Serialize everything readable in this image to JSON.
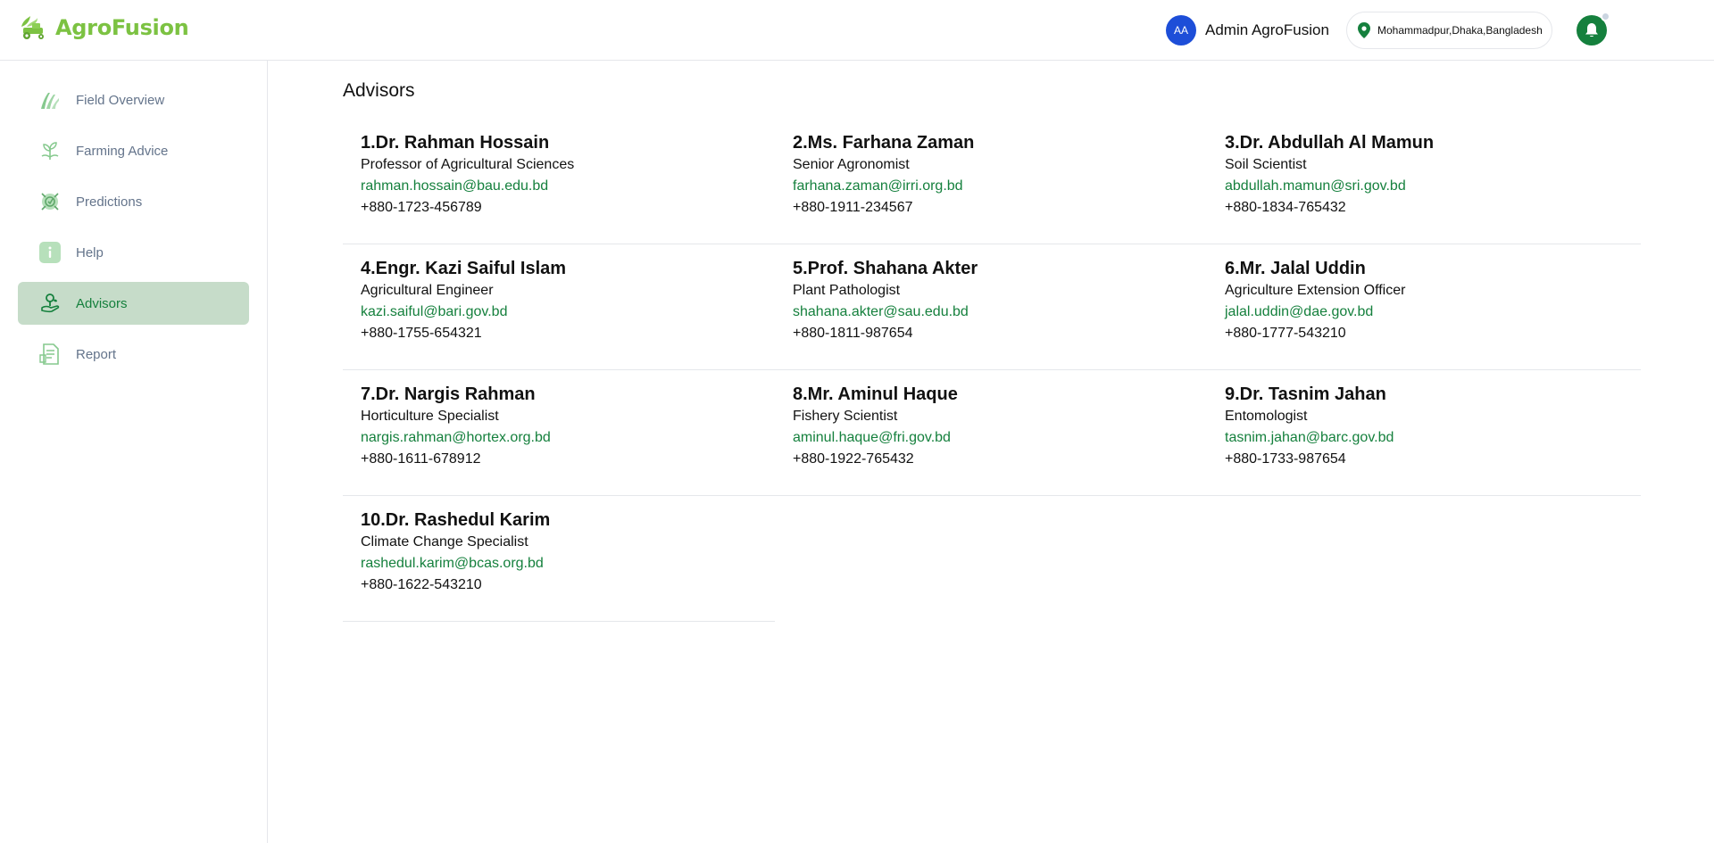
{
  "brand": {
    "name": "AgroFusion"
  },
  "header": {
    "avatar_initials": "AA",
    "user_name": "Admin AgroFusion",
    "location": "Mohammadpur,Dhaka,Bangladesh"
  },
  "colors": {
    "brand_green": "#7cc242",
    "accent_green": "#15803d",
    "active_bg": "#c6dcc9",
    "avatar_blue": "#1d4ed8"
  },
  "sidebar": {
    "items": [
      {
        "label": "Field Overview",
        "icon": "field-icon",
        "active": false
      },
      {
        "label": "Farming Advice",
        "icon": "sprout-icon",
        "active": false
      },
      {
        "label": "Predictions",
        "icon": "prediction-icon",
        "active": false
      },
      {
        "label": "Help",
        "icon": "info-icon",
        "active": false
      },
      {
        "label": "Advisors",
        "icon": "advisor-icon",
        "active": true
      },
      {
        "label": "Report",
        "icon": "report-icon",
        "active": false
      }
    ]
  },
  "main": {
    "title": "Advisors",
    "advisors": [
      {
        "name": "1.Dr. Rahman Hossain",
        "title": "Professor of Agricultural Sciences",
        "email": "rahman.hossain@bau.edu.bd",
        "phone": "+880-1723-456789"
      },
      {
        "name": "2.Ms. Farhana Zaman",
        "title": "Senior Agronomist",
        "email": "farhana.zaman@irri.org.bd",
        "phone": "+880-1911-234567"
      },
      {
        "name": "3.Dr. Abdullah Al Mamun",
        "title": "Soil Scientist",
        "email": "abdullah.mamun@sri.gov.bd",
        "phone": "+880-1834-765432"
      },
      {
        "name": "4.Engr. Kazi Saiful Islam",
        "title": "Agricultural Engineer",
        "email": "kazi.saiful@bari.gov.bd",
        "phone": "+880-1755-654321"
      },
      {
        "name": "5.Prof. Shahana Akter",
        "title": "Plant Pathologist",
        "email": "shahana.akter@sau.edu.bd",
        "phone": "+880-1811-987654"
      },
      {
        "name": "6.Mr. Jalal Uddin",
        "title": "Agriculture Extension Officer",
        "email": "jalal.uddin@dae.gov.bd",
        "phone": "+880-1777-543210"
      },
      {
        "name": "7.Dr. Nargis Rahman",
        "title": "Horticulture Specialist",
        "email": "nargis.rahman@hortex.org.bd",
        "phone": "+880-1611-678912"
      },
      {
        "name": "8.Mr. Aminul Haque",
        "title": "Fishery Scientist",
        "email": "aminul.haque@fri.gov.bd",
        "phone": "+880-1922-765432"
      },
      {
        "name": "9.Dr. Tasnim Jahan",
        "title": "Entomologist",
        "email": "tasnim.jahan@barc.gov.bd",
        "phone": "+880-1733-987654"
      },
      {
        "name": "10.Dr. Rashedul Karim",
        "title": "Climate Change Specialist",
        "email": "rashedul.karim@bcas.org.bd",
        "phone": "+880-1622-543210"
      }
    ]
  }
}
